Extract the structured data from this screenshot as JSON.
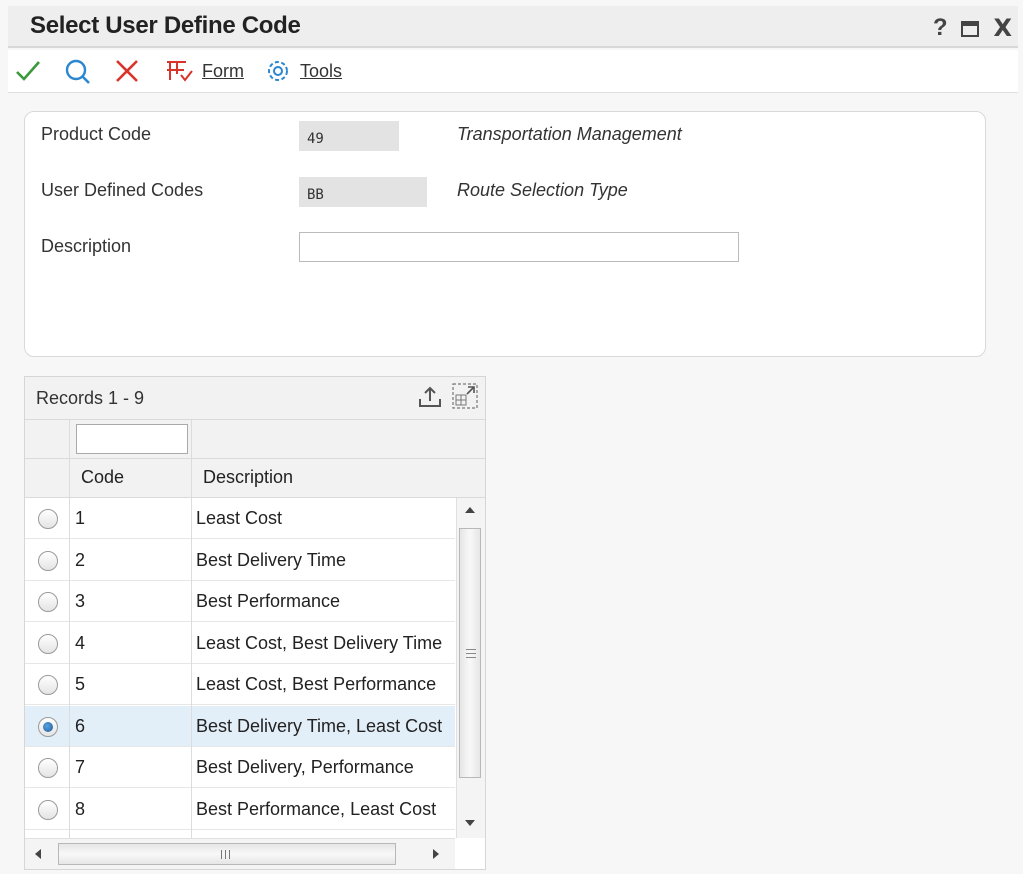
{
  "window": {
    "title": "Select User Define Code",
    "help_label": "?",
    "close_label": "X"
  },
  "toolbar": {
    "form_label": "Form",
    "tools_label": "Tools"
  },
  "header": {
    "product_code_label": "Product Code",
    "product_code_value": "49",
    "product_code_desc": "Transportation Management",
    "udc_label": "User Defined Codes",
    "udc_value": "BB",
    "udc_desc": "Route Selection Type",
    "description_label": "Description",
    "description_value": ""
  },
  "grid": {
    "records_label": "Records 1 - 9",
    "filter_value": "",
    "columns": {
      "code": "Code",
      "description": "Description"
    },
    "rows": [
      {
        "code": "1",
        "description": "Least Cost",
        "selected": false
      },
      {
        "code": "2",
        "description": "Best Delivery Time",
        "selected": false
      },
      {
        "code": "3",
        "description": "Best Performance",
        "selected": false
      },
      {
        "code": "4",
        "description": "Least Cost, Best Delivery Time",
        "selected": false
      },
      {
        "code": "5",
        "description": "Least Cost, Best Performance",
        "selected": false
      },
      {
        "code": "6",
        "description": "Best Delivery Time, Least Cost",
        "selected": true
      },
      {
        "code": "7",
        "description": "Best Delivery, Performance",
        "selected": false
      },
      {
        "code": "8",
        "description": "Best Performance, Least Cost",
        "selected": false
      }
    ]
  },
  "colors": {
    "check": "#3a9a3a",
    "find": "#2a87d0",
    "cancel": "#d9342b",
    "form_icon": "#d9342b",
    "tools_icon": "#2a87d0",
    "selected_row": "#e2eef8"
  },
  "icons": [
    "check-icon",
    "search-icon",
    "close-icon",
    "form-icon",
    "gear-icon",
    "export-icon",
    "expand-grid-icon"
  ]
}
